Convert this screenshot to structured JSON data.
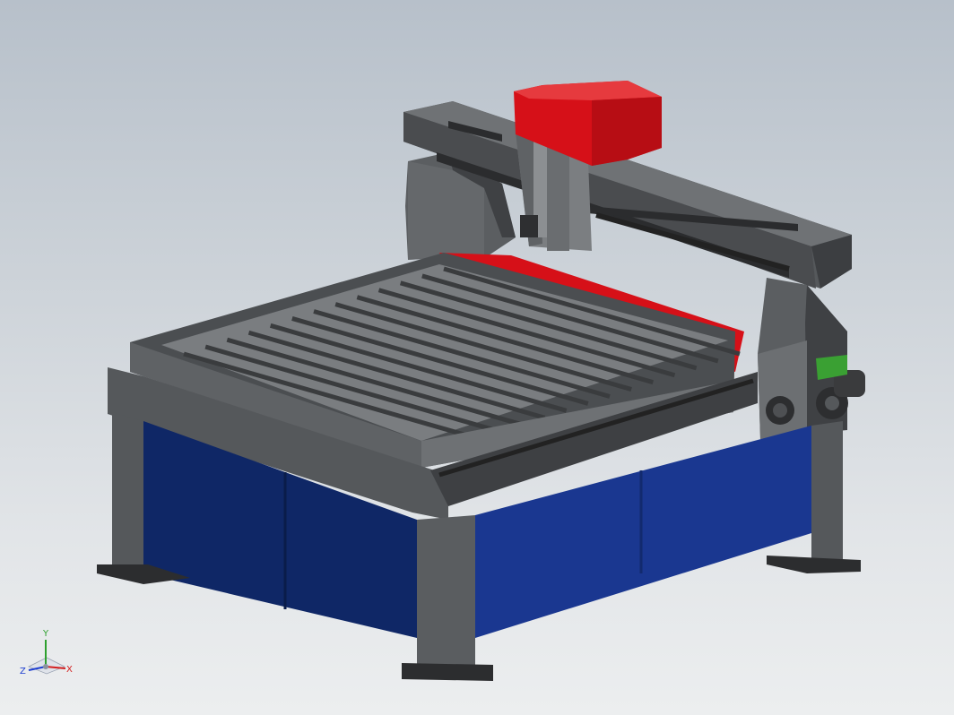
{
  "viewport": {
    "colors": {
      "machine_dark": "#4a4c4f",
      "machine_mid": "#6a6d70",
      "machine_light": "#8a8d90",
      "base_blue": "#1a3790",
      "base_blue_dark": "#0f2460",
      "accent_red": "#d4101a",
      "accent_green": "#3aa033"
    }
  },
  "triad": {
    "x_label": "X",
    "y_label": "Y",
    "z_label": "Z",
    "x_color": "#d42020",
    "y_color": "#2ea02e",
    "z_color": "#2040d0"
  }
}
